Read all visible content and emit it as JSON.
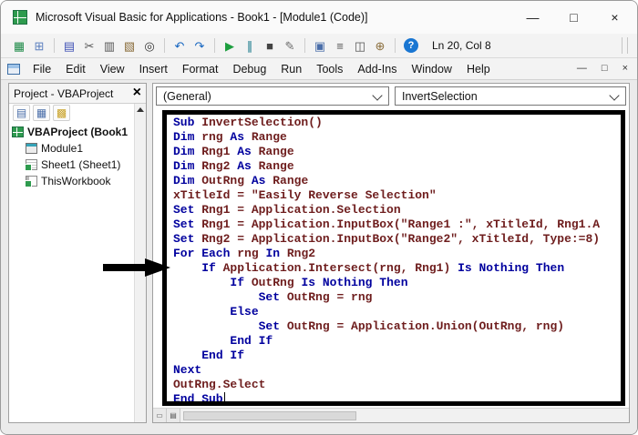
{
  "window": {
    "title": "Microsoft Visual Basic for Applications - Book1 - [Module1 (Code)]",
    "controls": [
      {
        "name": "minimize-button",
        "glyph": "—"
      },
      {
        "name": "maximize-button",
        "glyph": "□"
      },
      {
        "name": "close-button",
        "glyph": "×"
      }
    ]
  },
  "toolbar": {
    "position_indicator": "Ln 20, Col 8",
    "items": [
      {
        "name": "view-excel-icon",
        "glyph": "▦",
        "color": "#1d8a47"
      },
      {
        "name": "insert-object-icon",
        "glyph": "⊞",
        "color": "#5b7fbf"
      },
      {
        "sep": true
      },
      {
        "name": "save-icon",
        "glyph": "▤",
        "color": "#3f51b5"
      },
      {
        "name": "cut-icon",
        "glyph": "✂",
        "color": "#555555"
      },
      {
        "name": "copy-icon",
        "glyph": "▥",
        "color": "#555555"
      },
      {
        "name": "paste-icon",
        "glyph": "▧",
        "color": "#8a6d3b"
      },
      {
        "name": "find-icon",
        "glyph": "◎",
        "color": "#333333"
      },
      {
        "sep": true
      },
      {
        "name": "undo-icon",
        "glyph": "↶",
        "color": "#1565c0"
      },
      {
        "name": "redo-icon",
        "glyph": "↷",
        "color": "#1565c0"
      },
      {
        "sep": true
      },
      {
        "name": "run-icon",
        "glyph": "▶",
        "color": "#1d9e3e"
      },
      {
        "name": "break-icon",
        "glyph": "∥",
        "color": "#0b7285"
      },
      {
        "name": "reset-icon",
        "glyph": "■",
        "color": "#444444"
      },
      {
        "name": "design-mode-icon",
        "glyph": "✎",
        "color": "#6d6d6d"
      },
      {
        "sep": true
      },
      {
        "name": "project-explorer-icon",
        "glyph": "▣",
        "color": "#4a6ea9"
      },
      {
        "name": "properties-window-icon",
        "glyph": "≡",
        "color": "#555555"
      },
      {
        "name": "object-browser-icon",
        "glyph": "◫",
        "color": "#555555"
      },
      {
        "name": "toolbox-icon",
        "glyph": "⊕",
        "color": "#8a6d3b"
      },
      {
        "sep": true
      },
      {
        "name": "help-icon",
        "glyph": "?",
        "color": "#ffffff",
        "bg": "#1976d2",
        "round": true
      }
    ]
  },
  "menu": {
    "items": [
      "File",
      "Edit",
      "View",
      "Insert",
      "Format",
      "Debug",
      "Run",
      "Tools",
      "Add-Ins",
      "Window",
      "Help"
    ],
    "mdi_controls": [
      {
        "name": "mdi-minimize-button",
        "glyph": "—"
      },
      {
        "name": "mdi-restore-button",
        "glyph": "□"
      },
      {
        "name": "mdi-close-button",
        "glyph": "×"
      }
    ]
  },
  "project_panel": {
    "title": "Project - VBAProject",
    "close_glyph": "×",
    "toolbar_icons": [
      {
        "name": "view-code-icon",
        "glyph": "▤",
        "color": "#4a6ea9"
      },
      {
        "name": "view-object-icon",
        "glyph": "▦",
        "color": "#4a6ea9"
      },
      {
        "name": "toggle-folders-icon",
        "glyph": "▩",
        "color": "#c9a227"
      }
    ],
    "tree": [
      {
        "label": "VBAProject (Book1",
        "icon": "excel",
        "bold": true
      },
      {
        "label": "Module1",
        "icon": "module",
        "indent": true
      },
      {
        "label": "Sheet1 (Sheet1)",
        "icon": "sheet",
        "indent": true
      },
      {
        "label": "ThisWorkbook",
        "icon": "workbook",
        "indent": true
      }
    ]
  },
  "code_window": {
    "general_dropdown": "(General)",
    "procedure_dropdown": "InvertSelection",
    "caret_line": 20,
    "lines": [
      [
        [
          "k",
          "Sub"
        ],
        [
          "n",
          " InvertSelection()"
        ]
      ],
      [
        [
          "k",
          "Dim"
        ],
        [
          "n",
          " rng "
        ],
        [
          "k",
          "As"
        ],
        [
          "n",
          " Range"
        ]
      ],
      [
        [
          "k",
          "Dim"
        ],
        [
          "n",
          " Rng1 "
        ],
        [
          "k",
          "As"
        ],
        [
          "n",
          " Range"
        ]
      ],
      [
        [
          "k",
          "Dim"
        ],
        [
          "n",
          " Rng2 "
        ],
        [
          "k",
          "As"
        ],
        [
          "n",
          " Range"
        ]
      ],
      [
        [
          "k",
          "Dim"
        ],
        [
          "n",
          " OutRng "
        ],
        [
          "k",
          "As"
        ],
        [
          "n",
          " Range"
        ]
      ],
      [
        [
          "n",
          "xTitleId = \"Easily Reverse Selection\""
        ]
      ],
      [
        [
          "k",
          "Set"
        ],
        [
          "n",
          " Rng1 = Application.Selection"
        ]
      ],
      [
        [
          "k",
          "Set"
        ],
        [
          "n",
          " Rng1 = Application.InputBox(\"Range1 :\", xTitleId, Rng1.A"
        ]
      ],
      [
        [
          "k",
          "Set"
        ],
        [
          "n",
          " Rng2 = Application.InputBox(\"Range2\", xTitleId, Type:=8)"
        ]
      ],
      [
        [
          "k",
          "For Each"
        ],
        [
          "n",
          " rng "
        ],
        [
          "k",
          "In"
        ],
        [
          "n",
          " Rng2"
        ]
      ],
      [
        [
          "n",
          "    "
        ],
        [
          "k",
          "If"
        ],
        [
          "n",
          " Application.Intersect(rng, Rng1) "
        ],
        [
          "k",
          "Is"
        ],
        [
          "n",
          " "
        ],
        [
          "k",
          "Nothing"
        ],
        [
          "n",
          " "
        ],
        [
          "k",
          "Then"
        ]
      ],
      [
        [
          "n",
          "        "
        ],
        [
          "k",
          "If"
        ],
        [
          "n",
          " OutRng "
        ],
        [
          "k",
          "Is"
        ],
        [
          "n",
          " "
        ],
        [
          "k",
          "Nothing"
        ],
        [
          "n",
          " "
        ],
        [
          "k",
          "Then"
        ]
      ],
      [
        [
          "n",
          "            "
        ],
        [
          "k",
          "Set"
        ],
        [
          "n",
          " OutRng = rng"
        ]
      ],
      [
        [
          "n",
          "        "
        ],
        [
          "k",
          "Else"
        ]
      ],
      [
        [
          "n",
          "            "
        ],
        [
          "k",
          "Set"
        ],
        [
          "n",
          " OutRng = Application.Union(OutRng, rng)"
        ]
      ],
      [
        [
          "n",
          "        "
        ],
        [
          "k",
          "End If"
        ]
      ],
      [
        [
          "n",
          "    "
        ],
        [
          "k",
          "End If"
        ]
      ],
      [
        [
          "k",
          "Next"
        ]
      ],
      [
        [
          "n",
          "OutRng.Select"
        ]
      ],
      [
        [
          "k",
          "End Sub"
        ]
      ]
    ]
  },
  "colors": {
    "keyword": "#00009e",
    "code_text": "#6e1d1d",
    "annotation": "#000000"
  }
}
